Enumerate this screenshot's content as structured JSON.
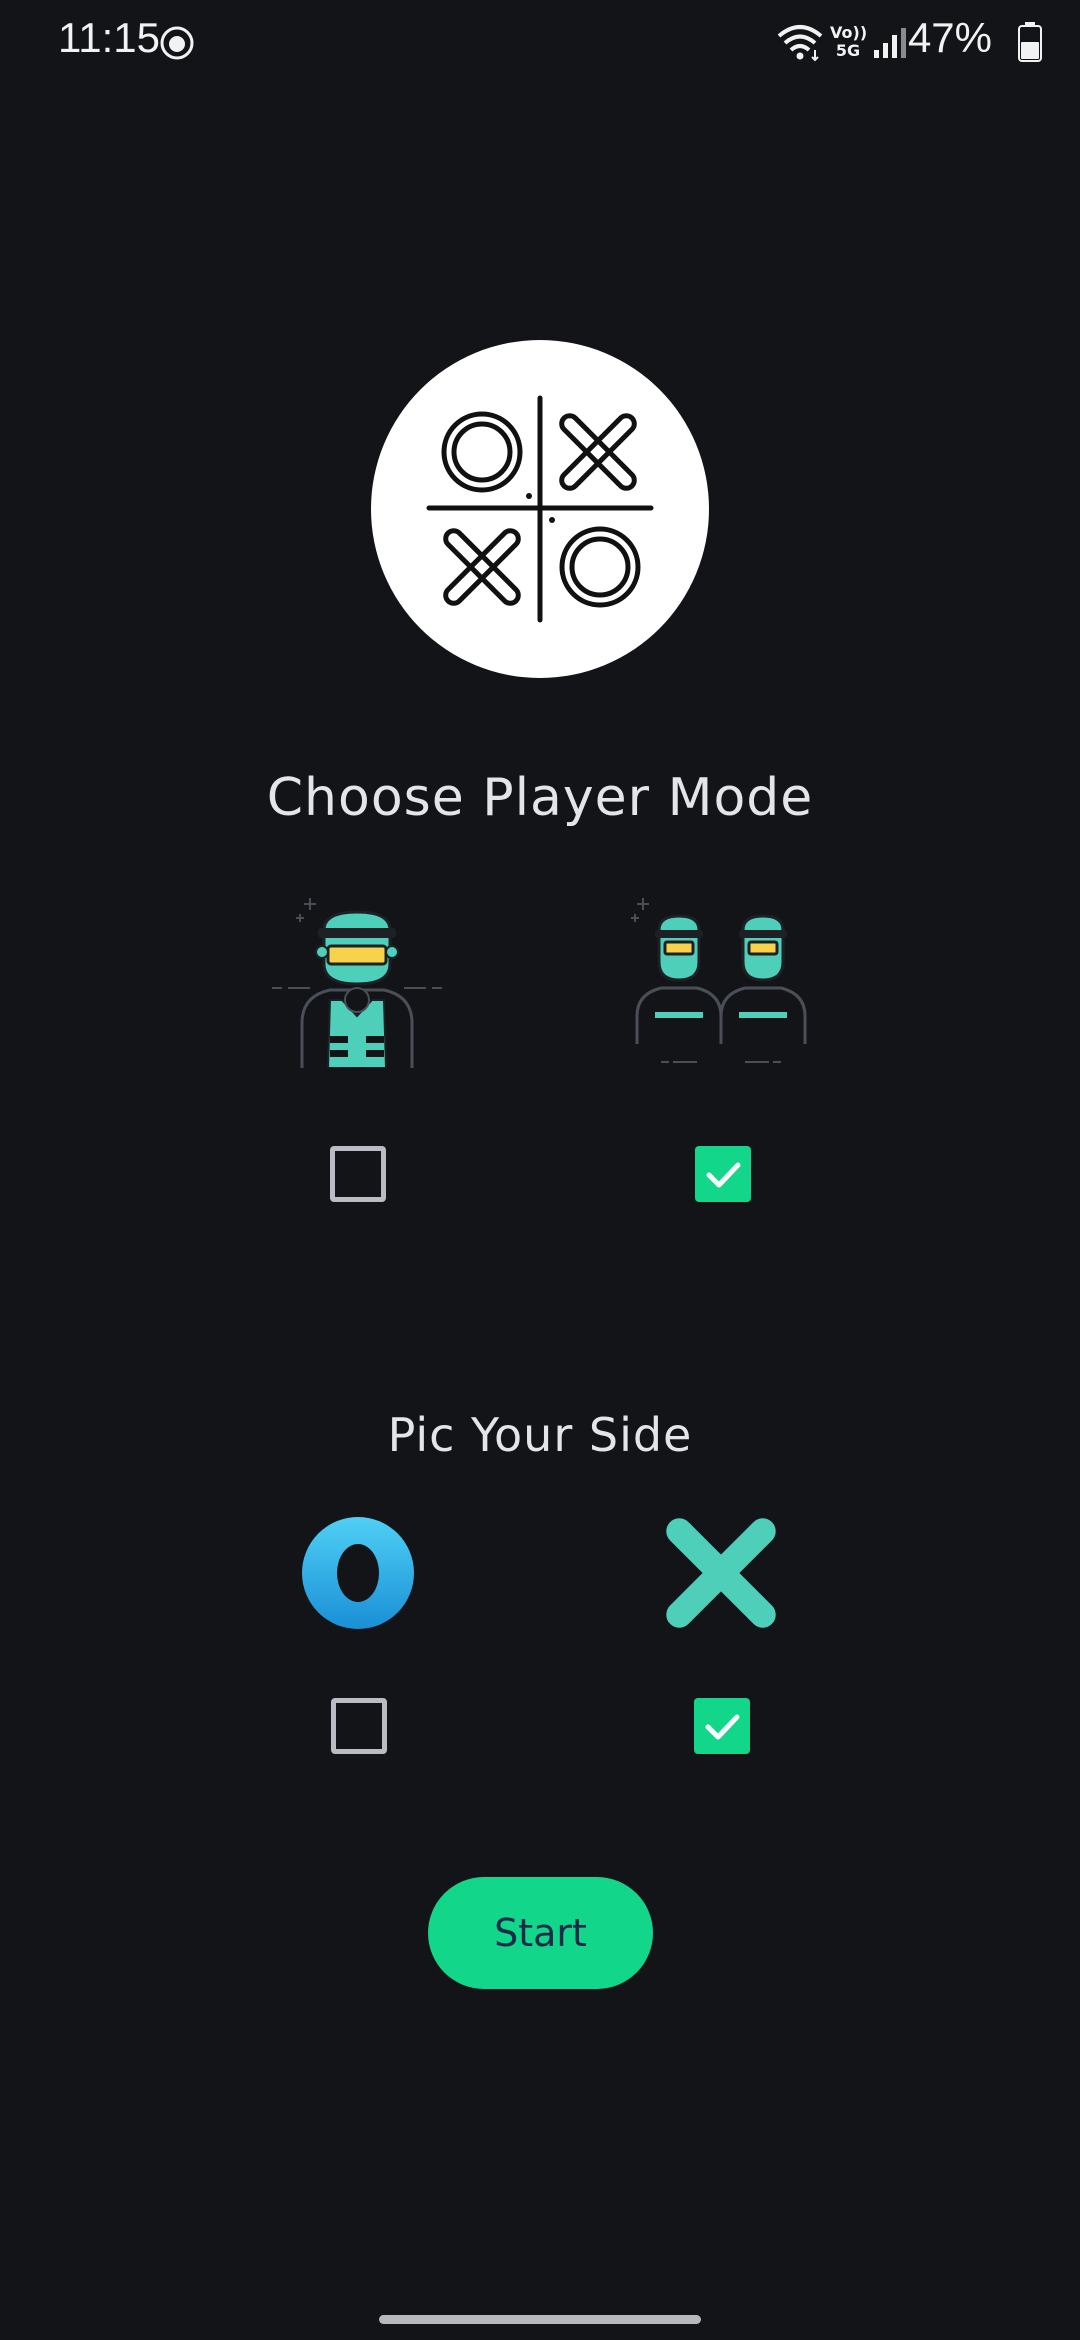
{
  "status_bar": {
    "time": "11:15",
    "battery_percent": "47%",
    "network_label_top": "Vo))",
    "network_label_bottom": "5G",
    "icons": [
      "wifi-icon",
      "signal-icon",
      "battery-icon"
    ]
  },
  "player_mode": {
    "title": "Choose Player Mode",
    "options": [
      {
        "id": "single-player",
        "icon": "single-soldier-icon",
        "checked": false
      },
      {
        "id": "two-player",
        "icon": "two-soldiers-icon",
        "checked": true
      }
    ]
  },
  "side": {
    "title": "Pic Your Side",
    "options": [
      {
        "id": "o",
        "icon": "o-symbol-icon",
        "checked": false
      },
      {
        "id": "x",
        "icon": "x-symbol-icon",
        "checked": true
      }
    ]
  },
  "start_button": {
    "label": "Start"
  },
  "colors": {
    "background": "#121418",
    "accent": "#12d68a",
    "teal": "#4ecfb9",
    "o_blue": "#29b3ea",
    "visor": "#f7d24a"
  }
}
